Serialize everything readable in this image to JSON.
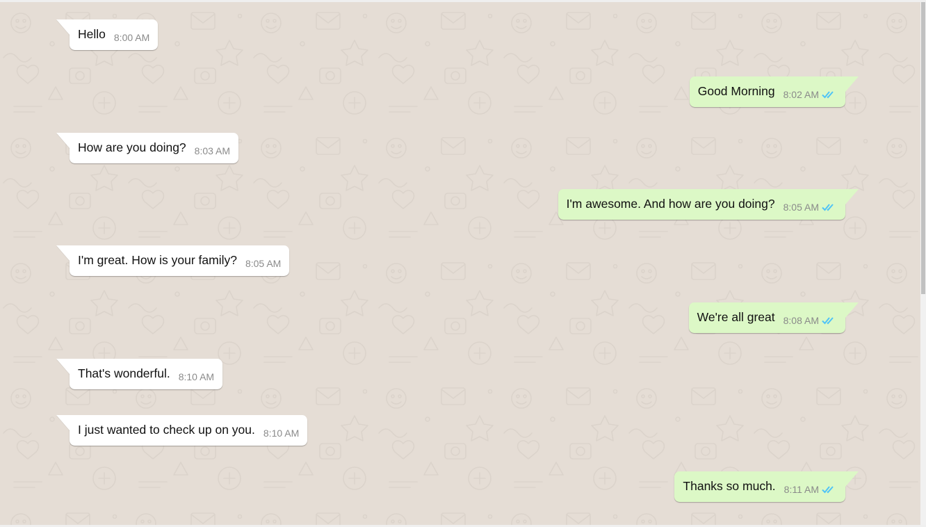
{
  "chat": {
    "messages": [
      {
        "direction": "in",
        "text": "Hello",
        "time": "8:00 AM"
      },
      {
        "direction": "out",
        "text": "Good Morning",
        "time": "8:02 AM",
        "status_icon": "double-check-icon"
      },
      {
        "direction": "in",
        "text": "How are you doing?",
        "time": "8:03 AM"
      },
      {
        "direction": "out",
        "text": "I'm awesome. And how are you doing?",
        "time": "8:05 AM",
        "status_icon": "double-check-icon"
      },
      {
        "direction": "in",
        "text": "I'm great. How is your family?",
        "time": "8:05 AM"
      },
      {
        "direction": "out",
        "text": "We're all great",
        "time": "8:08 AM",
        "status_icon": "double-check-icon"
      },
      {
        "direction": "in",
        "text": "That's wonderful.",
        "time": "8:10 AM"
      },
      {
        "direction": "in",
        "text": "I just wanted to check up on you.",
        "time": "8:10 AM"
      },
      {
        "direction": "out",
        "text": "Thanks so much.",
        "time": "8:11 AM",
        "status_icon": "double-check-icon"
      }
    ]
  },
  "colors": {
    "wallpaper": "#e5ddd5",
    "incoming_bubble": "#ffffff",
    "outgoing_bubble": "#dcf8c6",
    "read_tick": "#4fc3f7",
    "timestamp": "#8a8a8a"
  }
}
